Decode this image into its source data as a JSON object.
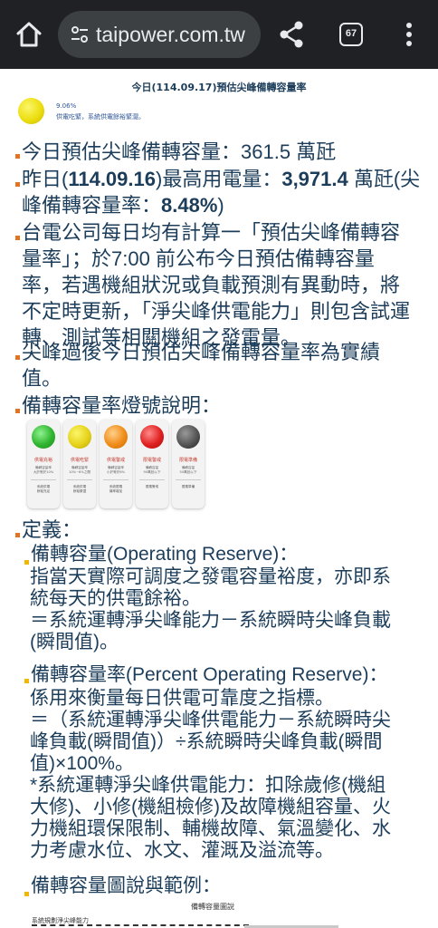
{
  "browser": {
    "url": "taipower.com.tw",
    "tab_count": "67",
    "icons": [
      "home-icon",
      "tune-icon",
      "share-icon",
      "tab-switcher-icon",
      "overflow-menu-icon"
    ]
  },
  "header": {
    "title": "今日(114.09.17)預估尖峰備轉容量率",
    "light_color": "#ecdf10",
    "percent": "9.06%",
    "status": "供電吃緊，系統供電餘裕緊澀。"
  },
  "info": {
    "p1": "今日預估尖峰備轉容量：361.5 萬瓩",
    "p2_a": "昨日(",
    "p2_date": "114.09.16",
    "p2_b": ")最高用電量：",
    "p2_val": "3,971.4",
    "p2_c": " 萬瓩(尖",
    "p2_d": "峰備轉容量率：",
    "p2_rate": "8.48%",
    "p2_e": ")",
    "p3": [
      "台電公司每日均有計算一「預估尖峰備轉容",
      "量率」；於7:00 前公布今日預估備轉容量",
      "率，若遇機組狀況或負載預測有異動時，將",
      "不定時更新，「淨尖峰供電能力」則包含試運",
      "轉、測試等相關機組之發電量。"
    ],
    "p4": [
      "尖峰過後今日預估尖峰備轉容量率為實績",
      "值。"
    ],
    "legend_heading": "備轉容量率燈號說明："
  },
  "legend": [
    {
      "title": "供電充裕",
      "desc": [
        "備轉容量率",
        "大於等於10%"
      ],
      "foot": [
        "系統供電",
        "餘裕充足"
      ],
      "color": "#2fb52f"
    },
    {
      "title": "供電吃緊",
      "desc": [
        "備轉容量率",
        "10%~6%之間"
      ],
      "foot": [
        "系統供電",
        "餘裕緊澀"
      ],
      "color": "#e6d21a"
    },
    {
      "title": "供電警戒",
      "desc": [
        "備轉容量率",
        "小於等於6%"
      ],
      "foot": [
        "系統限電",
        "機率增加"
      ],
      "color": "#f08c1a"
    },
    {
      "title": "限電警戒",
      "desc": [
        "備轉容量",
        "90萬瓩以下"
      ],
      "foot": [
        "限電警戒"
      ],
      "color": "#e02020"
    },
    {
      "title": "限電準備",
      "desc": [
        "備轉容量",
        "50萬瓩以下"
      ],
      "foot": [
        "限電準備"
      ],
      "color": "#555555"
    }
  ],
  "definitions": {
    "heading": "定義：",
    "d1_title": "備轉容量(Operating Reserve)：",
    "d1_body": [
      "指當天實際可調度之發電容量裕度，亦即系",
      "統每天的供電餘裕。",
      "＝系統運轉淨尖峰能力－系統瞬時尖峰負載",
      "(瞬間值)。"
    ],
    "d2_title": "備轉容量率(Percent Operating Reserve)：",
    "d2_body": [
      "係用來衡量每日供電可靠度之指標。",
      "＝（系統運轉淨尖峰供電能力－系統瞬時尖",
      "峰負載(瞬間值)）÷系統瞬時尖峰負載(瞬間",
      "值)×100%。",
      "*系統運轉淨尖峰供電能力：扣除歲修(機組",
      "大修)、小修(機組檢修)及故障機組容量、火",
      "力機組環保限制、輔機故障、氣溫變化、水",
      "力考慮水位、水文、灌溉及溢流等。"
    ],
    "d3_title": "備轉容量圖說與範例："
  },
  "chart": {
    "title": "備轉容量圖說",
    "label": "系統規劃淨尖峰能力"
  }
}
